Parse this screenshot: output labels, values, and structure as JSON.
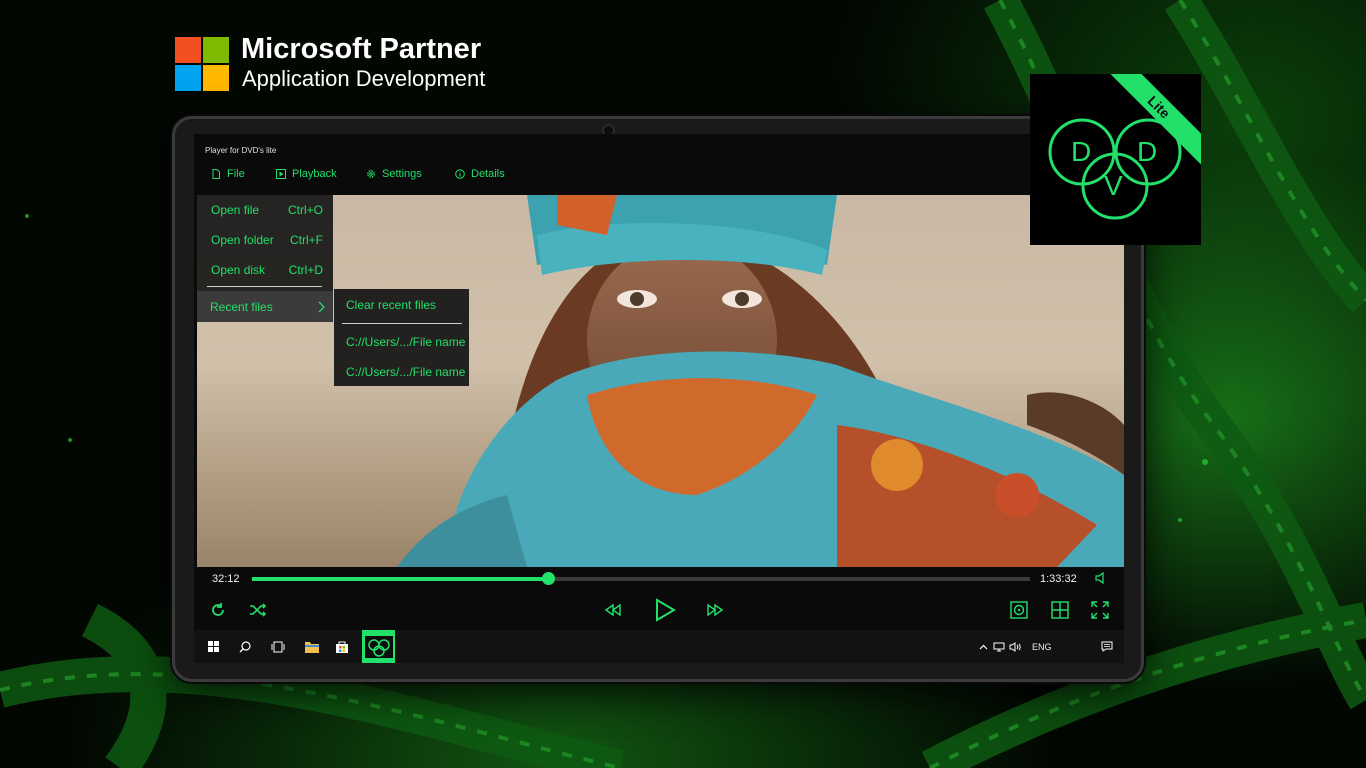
{
  "partner": {
    "title": "Microsoft Partner",
    "subtitle": "Application Development"
  },
  "app": {
    "window_title": "Player for DVD's lite",
    "menu": {
      "file": "File",
      "playback": "Playback",
      "settings": "Settings",
      "details": "Details"
    },
    "file_menu": {
      "open_file": "Open file",
      "open_file_shortcut": "Ctrl+O",
      "open_folder": "Open folder",
      "open_folder_shortcut": "Ctrl+F",
      "open_disk": "Open disk",
      "open_disk_shortcut": "Ctrl+D",
      "recent_files": "Recent files"
    },
    "recent_submenu": {
      "clear": "Clear recent files",
      "items": [
        "C://Users/.../File name",
        "C://Users/.../File name"
      ]
    },
    "player": {
      "elapsed": "32:12",
      "duration": "1:33:32",
      "progress_fraction": 0.38
    },
    "taskbar": {
      "language": "ENG"
    }
  },
  "dvd_logo": {
    "letters": [
      "D",
      "D",
      "V"
    ],
    "ribbon": "Lite"
  },
  "colors": {
    "accent": "#22e06a",
    "background": "#020702",
    "menu_bg": "#141414"
  }
}
